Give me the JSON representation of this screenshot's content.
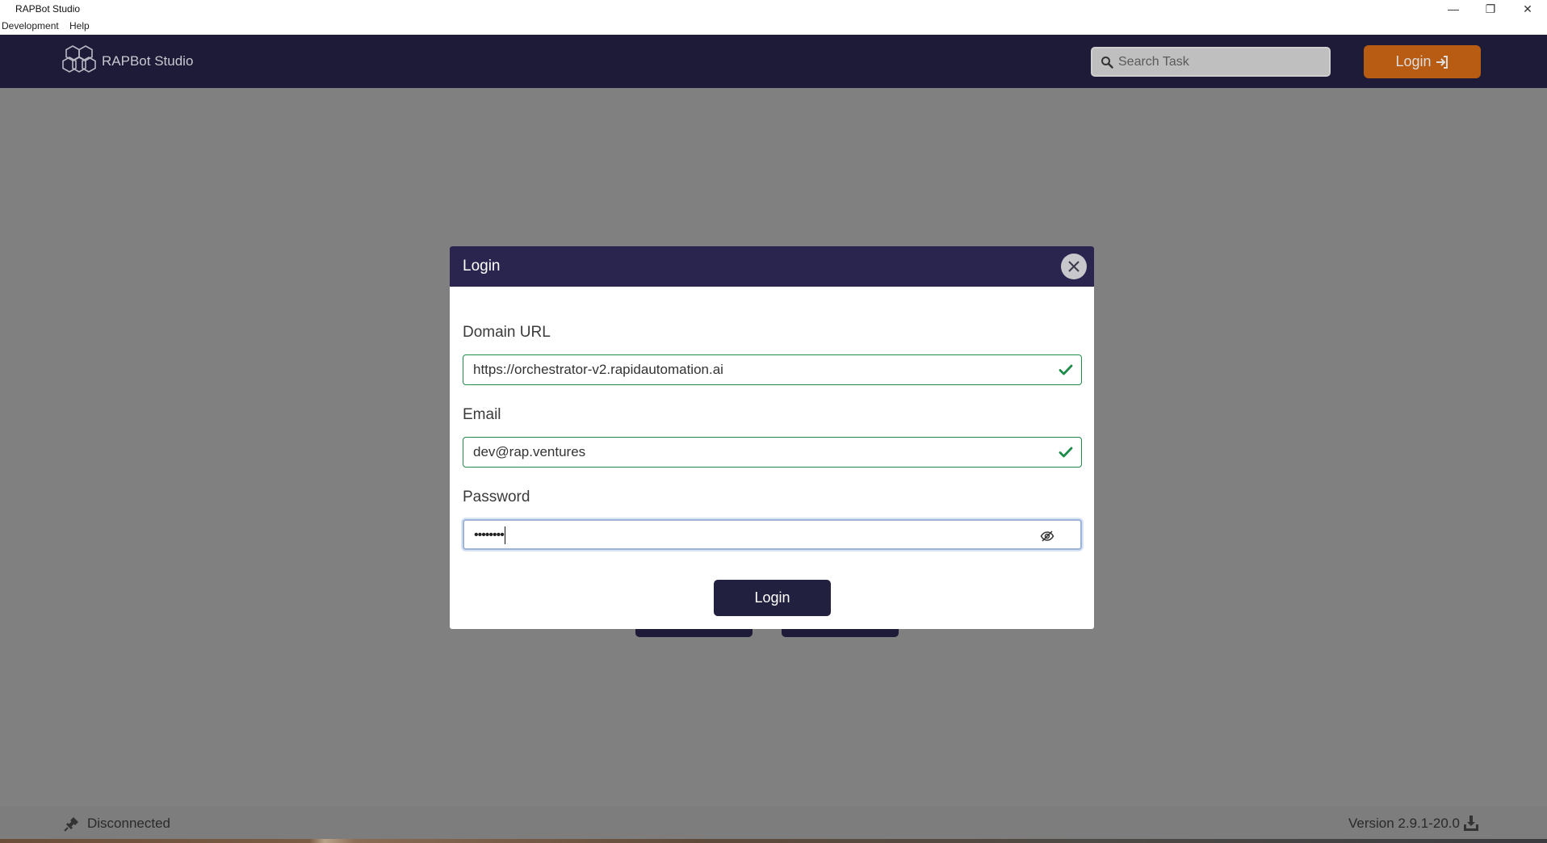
{
  "window": {
    "title": "RAPBot Studio",
    "minimize": "—",
    "maximize": "❐",
    "close": "✕"
  },
  "menu": {
    "items": [
      "Development",
      "Help"
    ]
  },
  "header": {
    "brand": "RAPBot Studio",
    "search_placeholder": "Search Task",
    "login_label": "Login"
  },
  "modal": {
    "title": "Login",
    "domain_label": "Domain URL",
    "domain_value": "https://orchestrator-v2.rapidautomation.ai",
    "email_label": "Email",
    "email_value": "dev@rap.ventures",
    "password_label": "Password",
    "password_mask": "••••••••",
    "submit_label": "Login"
  },
  "status": {
    "connection": "Disconnected",
    "version": "Version 2.9.1-20.0"
  },
  "colors": {
    "appbar": "#1d1b37",
    "modal_header": "#29254f",
    "accent_orange": "#b75c12",
    "valid_green": "#1f8c4a",
    "overlay_gray": "#808080"
  },
  "icons": [
    "logo-hexagon-icon",
    "search-icon",
    "login-arrow-icon",
    "close-icon",
    "check-icon",
    "eye-off-icon",
    "plug-icon",
    "download-icon"
  ]
}
